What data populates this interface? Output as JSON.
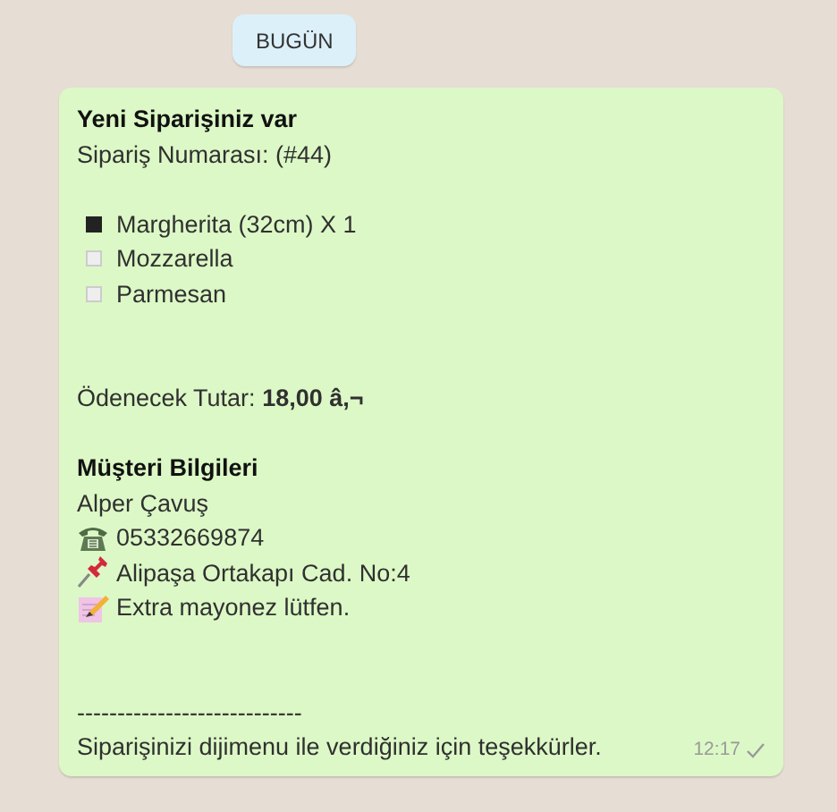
{
  "date_chip": "BUGÜN",
  "message": {
    "title": "Yeni Siparişiniz var",
    "order_number": "Sipariş Numarası: (#44)",
    "items": [
      {
        "label": "Margherita (32cm) X 1",
        "checked": true
      },
      {
        "label": "Mozzarella",
        "checked": false
      },
      {
        "label": "Parmesan",
        "checked": false
      }
    ],
    "total": "Ödenecek Tutar: **18,00 â,¬**",
    "customer_heading": "Müşteri Bilgileri",
    "customer_name": "Alper Çavuş",
    "details": [
      {
        "kind": "phone",
        "text": "05332669874"
      },
      {
        "kind": "pin",
        "text": "Alipaşa Ortakapı Cad. No:4"
      },
      {
        "kind": "memo",
        "text": "Extra mayonez lütfen."
      }
    ],
    "separator": "----------------------------",
    "footer": "Siparişinizi dijimenu ile verdiğiniz için teşekkürler.",
    "time": "12:17",
    "delivered": false
  }
}
